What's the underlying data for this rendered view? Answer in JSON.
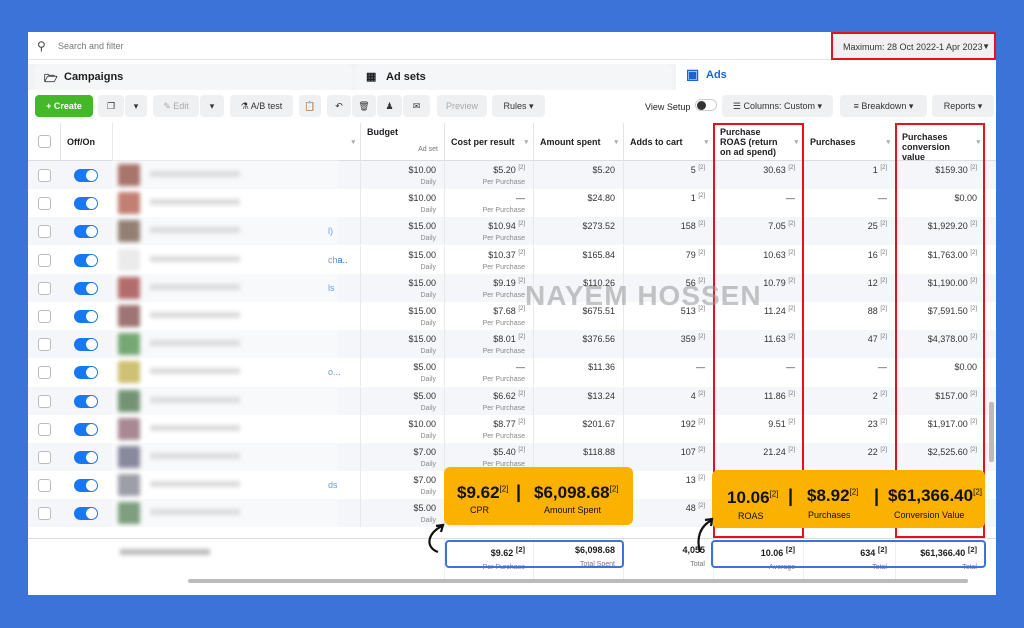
{
  "search": {
    "placeholder": "Search and filter",
    "icon": "search-icon"
  },
  "date_range": "Maximum: 28 Oct 2022-1 Apr 2023",
  "tabs": [
    {
      "label": "Campaigns",
      "icon": "folder-icon"
    },
    {
      "label": "Ad sets",
      "icon": "grid-icon"
    },
    {
      "label": "Ads",
      "icon": "ad-icon"
    }
  ],
  "toolbar": {
    "create": "Create",
    "edit": "Edit",
    "ab_test": "A/B test",
    "preview": "Preview",
    "rules": "Rules",
    "view_setup": "View Setup",
    "columns": "Columns: Custom",
    "breakdown": "Breakdown",
    "reports": "Reports"
  },
  "headers": {
    "offon": "Off/On",
    "budget": "Budget",
    "budget_sub": "Ad set",
    "cpr": "Cost per result",
    "amount": "Amount spent",
    "adds": "Adds to cart",
    "roas": "Purchase ROAS (return on ad spend)",
    "purchases": "Purchases",
    "conv": "Purchases conversion value"
  },
  "rows": [
    {
      "link": "",
      "budget": "$10.00",
      "budget_sub": "Daily",
      "cpr": "$5.20",
      "cpr_sub": "Per Purchase",
      "amount": "$5.20",
      "adds": "5",
      "roas": "30.63",
      "purchases": "1",
      "conv": "$159.30"
    },
    {
      "link": "",
      "budget": "$10.00",
      "budget_sub": "Daily",
      "cpr": "—",
      "cpr_sub": "Per Purchase",
      "amount": "$24.80",
      "adds": "1",
      "roas": "—",
      "purchases": "—",
      "conv": "$0.00"
    },
    {
      "link": "l)",
      "budget": "$15.00",
      "budget_sub": "Daily",
      "cpr": "$10.94",
      "cpr_sub": "Per Purchase",
      "amount": "$273.52",
      "adds": "158",
      "roas": "7.05",
      "purchases": "25",
      "conv": "$1,929.20"
    },
    {
      "link": "cha..",
      "budget": "$15.00",
      "budget_sub": "Daily",
      "cpr": "$10.37",
      "cpr_sub": "Per Purchase",
      "amount": "$165.84",
      "adds": "79",
      "roas": "10.63",
      "purchases": "16",
      "conv": "$1,763.00"
    },
    {
      "link": "ls",
      "budget": "$15.00",
      "budget_sub": "Daily",
      "cpr": "$9.19",
      "cpr_sub": "Per Purchase",
      "amount": "$110.26",
      "adds": "56",
      "roas": "10.79",
      "purchases": "12",
      "conv": "$1,190.00"
    },
    {
      "link": "",
      "budget": "$15.00",
      "budget_sub": "Daily",
      "cpr": "$7.68",
      "cpr_sub": "Per Purchase",
      "amount": "$675.51",
      "adds": "513",
      "roas": "11.24",
      "purchases": "88",
      "conv": "$7,591.50"
    },
    {
      "link": "",
      "budget": "$15.00",
      "budget_sub": "Daily",
      "cpr": "$8.01",
      "cpr_sub": "Per Purchase",
      "amount": "$376.56",
      "adds": "359",
      "roas": "11.63",
      "purchases": "47",
      "conv": "$4,378.00"
    },
    {
      "link": "o...",
      "budget": "$5.00",
      "budget_sub": "Daily",
      "cpr": "—",
      "cpr_sub": "Per Purchase",
      "amount": "$11.36",
      "adds": "—",
      "roas": "—",
      "purchases": "—",
      "conv": "$0.00"
    },
    {
      "link": "",
      "budget": "$5.00",
      "budget_sub": "Daily",
      "cpr": "$6.62",
      "cpr_sub": "Per Purchase",
      "amount": "$13.24",
      "adds": "4",
      "roas": "11.86",
      "purchases": "2",
      "conv": "$157.00"
    },
    {
      "link": "",
      "budget": "$10.00",
      "budget_sub": "Daily",
      "cpr": "$8.77",
      "cpr_sub": "Per Purchase",
      "amount": "$201.67",
      "adds": "192",
      "roas": "9.51",
      "purchases": "23",
      "conv": "$1,917.00"
    },
    {
      "link": "",
      "budget": "$7.00",
      "budget_sub": "Daily",
      "cpr": "$5.40",
      "cpr_sub": "Per Purchase",
      "amount": "$118.88",
      "adds": "107",
      "roas": "21.24",
      "purchases": "22",
      "conv": "$2,525.60"
    },
    {
      "link": "ds",
      "budget": "$7.00",
      "budget_sub": "Daily",
      "cpr": "",
      "cpr_sub": "",
      "amount": "",
      "adds": "13",
      "roas": "",
      "purchases": "",
      "conv": ""
    },
    {
      "link": "",
      "budget": "$5.00",
      "budget_sub": "Daily",
      "cpr": "",
      "cpr_sub": "",
      "amount": "",
      "adds": "48",
      "roas": "",
      "purchases": "",
      "conv": ""
    }
  ],
  "totals": {
    "cpr": "$9.62",
    "cpr_sub": "Per Purchase",
    "amount": "$6,098.68",
    "amount_sub": "Total Spent",
    "adds": "4,055",
    "adds_sub": "Total",
    "roas": "10.06",
    "roas_sub": "Average",
    "purchases": "634",
    "purchases_sub": "Total",
    "conv": "$61,366.40",
    "conv_sub": "Total"
  },
  "callout_left": {
    "cpr": "$9.62",
    "cpr_label": "CPR",
    "amount": "$6,098.68",
    "amount_label": "Amount Spent"
  },
  "callout_right": {
    "roas": "10.06",
    "roas_label": "ROAS",
    "purchases": "$8.92",
    "purchases_label": "Purchases",
    "conv": "$61,366.40",
    "conv_label": "Conversion Value"
  },
  "footnote": "[2]",
  "watermark": "NAYEM HOSSEN",
  "colors": {
    "background": "#3b73d9",
    "highlight_red": "#e3131e",
    "callout": "#fbb100",
    "create": "#43b929",
    "toggle_on": "#1877f2"
  }
}
